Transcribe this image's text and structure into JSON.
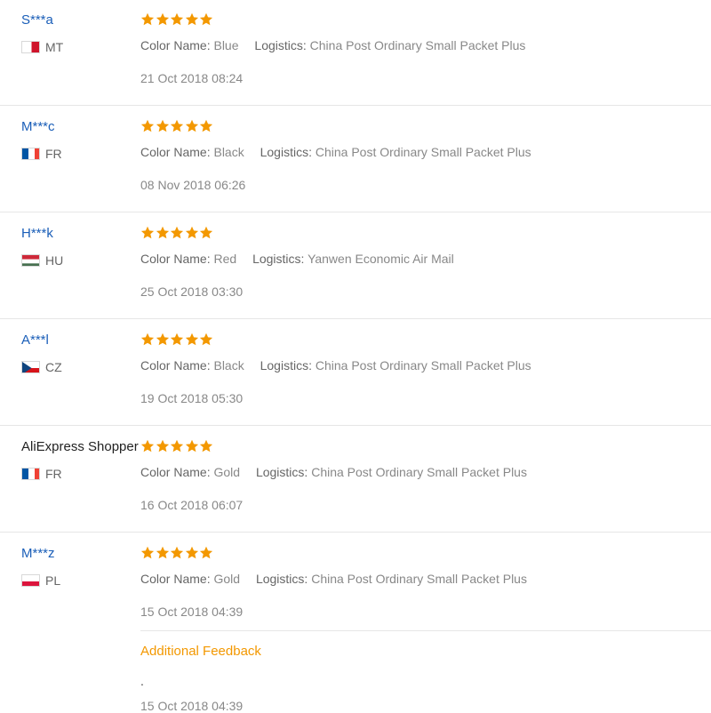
{
  "labels": {
    "color_name": "Color Name:",
    "logistics": "Logistics:"
  },
  "colors": {
    "star": "#f39800",
    "username_link": "#1a5eb8",
    "additional_feedback": "#f39800"
  },
  "reviews": [
    {
      "user": "S***a",
      "country": "MT",
      "flag": "flag-mt",
      "rating": 5,
      "color": "Blue",
      "logistics": "China Post Ordinary Small Packet Plus",
      "date": "21 Oct 2018 08:24"
    },
    {
      "user": "M***c",
      "country": "FR",
      "flag": "flag-fr",
      "rating": 5,
      "color": "Black",
      "logistics": "China Post Ordinary Small Packet Plus",
      "date": "08 Nov 2018 06:26"
    },
    {
      "user": "H***k",
      "country": "HU",
      "flag": "flag-hu",
      "rating": 5,
      "color": "Red",
      "logistics": "Yanwen Economic Air Mail",
      "date": "25 Oct 2018 03:30"
    },
    {
      "user": "A***l",
      "country": "CZ",
      "flag": "flag-cz",
      "rating": 5,
      "color": "Black",
      "logistics": "China Post Ordinary Small Packet Plus",
      "date": "19 Oct 2018 05:30"
    },
    {
      "user": "AliExpress Shopper",
      "country": "FR",
      "flag": "flag-fr",
      "rating": 5,
      "color": "Gold",
      "logistics": "China Post Ordinary Small Packet Plus",
      "date": "16 Oct 2018 06:07"
    },
    {
      "user": "M***z",
      "country": "PL",
      "flag": "flag-pl",
      "rating": 5,
      "color": "Gold",
      "logistics": "China Post Ordinary Small Packet Plus",
      "date": "15 Oct 2018 04:39"
    }
  ],
  "additional_feedback": {
    "title": "Additional Feedback",
    "text": ".",
    "date": "15 Oct 2018 04:39"
  }
}
